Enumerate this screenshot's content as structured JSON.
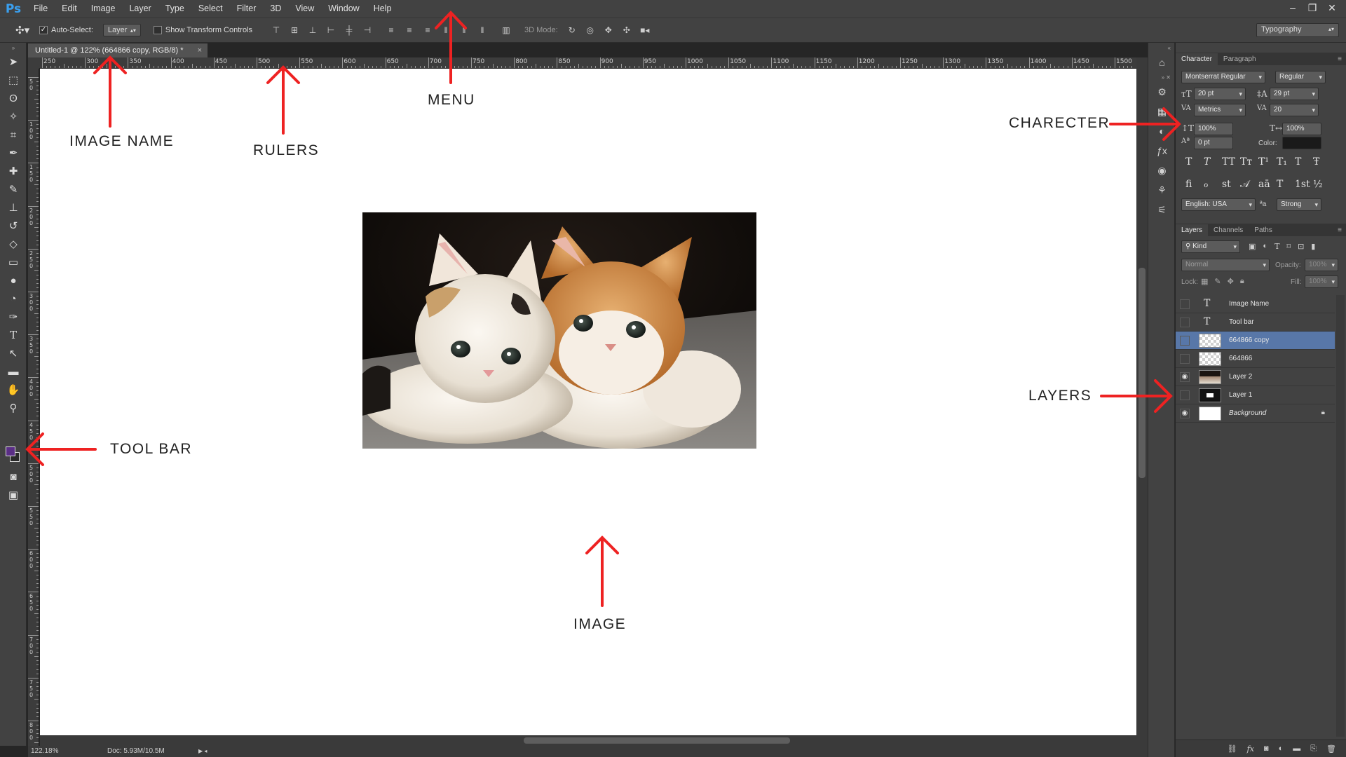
{
  "app": {
    "logo": "Ps"
  },
  "menu": {
    "items": [
      "File",
      "Edit",
      "Image",
      "Layer",
      "Type",
      "Select",
      "Filter",
      "3D",
      "View",
      "Window",
      "Help"
    ]
  },
  "window_controls": {
    "minimize": "–",
    "restore": "❐",
    "close": "✕"
  },
  "options_bar": {
    "auto_select_label": "Auto-Select:",
    "auto_select_checked": true,
    "auto_select_target": "Layer",
    "show_transform_label": "Show Transform Controls",
    "show_transform_checked": false,
    "mode_3d_label": "3D Mode:",
    "workspace": "Typography"
  },
  "document": {
    "tab_title": "Untitled-1 @ 122% (664866 copy, RGB/8) *",
    "close": "×",
    "zoom": "122.18%",
    "doc_size": "Doc: 5.93M/10.5M"
  },
  "rulers": {
    "horizontal": [
      "250",
      "300",
      "350",
      "400",
      "450",
      "500",
      "550",
      "600",
      "650",
      "700",
      "750",
      "800",
      "850",
      "900",
      "950",
      "1000",
      "1050",
      "1100",
      "1150",
      "1200",
      "1250",
      "1300",
      "1350",
      "1400",
      "1450",
      "1500"
    ],
    "vertical": [
      "50",
      "100",
      "150",
      "200",
      "250",
      "300",
      "350",
      "400",
      "450",
      "500",
      "550",
      "600",
      "650",
      "700",
      "750",
      "800"
    ]
  },
  "annotations": {
    "menu": "MENU",
    "image_name": "IMAGE NAME",
    "rulers": "RULERS",
    "charecter": "CHARECTER",
    "layers": "LAYERS",
    "tool_bar": "TOOL BAR",
    "image": "IMAGE"
  },
  "character_panel": {
    "tabs": [
      "Character",
      "Paragraph"
    ],
    "font_family": "Montserrat Regular",
    "font_style": "Regular",
    "size": "20 pt",
    "leading": "29 pt",
    "kerning": "Metrics",
    "tracking": "20",
    "vertical_scale": "100%",
    "horizontal_scale": "100%",
    "baseline_shift": "0 pt",
    "color_label": "Color:",
    "color": "#1a1a1a",
    "style_buttons": [
      "T",
      "T",
      "TT",
      "Tт",
      "T¹",
      "T₁",
      "T",
      "Ŧ"
    ],
    "opentype_buttons": [
      "ﬁ",
      "ℴ",
      "st",
      "𝒜",
      "aā",
      "T",
      "1st",
      "½"
    ],
    "language": "English: USA",
    "aa_label": "ªa",
    "anti_alias": "Strong"
  },
  "layers_panel": {
    "tabs": [
      "Layers",
      "Channels",
      "Paths"
    ],
    "filter": "Kind",
    "blend_mode": "Normal",
    "opacity_label": "Opacity:",
    "opacity": "100%",
    "lock_label": "Lock:",
    "fill_label": "Fill:",
    "fill": "100%",
    "layers": [
      {
        "name": "Image Name",
        "kind": "text",
        "visible": false,
        "selected": false
      },
      {
        "name": "Tool bar",
        "kind": "text",
        "visible": false,
        "selected": false
      },
      {
        "name": "664866 copy",
        "kind": "transparent",
        "visible": false,
        "selected": true
      },
      {
        "name": "664866",
        "kind": "transparent",
        "visible": false,
        "selected": false
      },
      {
        "name": "Layer 2",
        "kind": "photo",
        "visible": true,
        "selected": false
      },
      {
        "name": "Layer 1",
        "kind": "dark",
        "visible": false,
        "selected": false
      },
      {
        "name": "Background",
        "kind": "white",
        "visible": true,
        "selected": false,
        "locked": true
      }
    ]
  }
}
